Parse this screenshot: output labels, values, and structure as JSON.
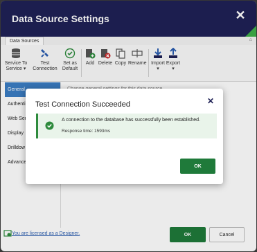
{
  "window": {
    "title": "Data Source Settings"
  },
  "ribbon": {
    "tab": "Data Sources",
    "buttons": {
      "service": "Service To\nService ▾",
      "test": "Test\nConnection",
      "set_default": "Set as\nDefault",
      "add": "Add",
      "delete": "Delete",
      "copy": "Copy",
      "rename": "Rename",
      "import": "Import\n▾",
      "export": "Export\n▾"
    }
  },
  "sidebar": {
    "items": [
      {
        "label": "General",
        "active": true
      },
      {
        "label": "Authenti"
      },
      {
        "label": "Web Serv"
      },
      {
        "label": "Display"
      },
      {
        "label": "Drilldow"
      },
      {
        "label": "Advance"
      }
    ]
  },
  "content": {
    "description": "Change general settings for this data source"
  },
  "footer": {
    "license": "You are licensed as a Designer.",
    "ok_label": "OK",
    "cancel_label": "Cancel"
  },
  "dialog": {
    "title": "Test Connection Succeeded",
    "message": "A connection to the database has successfully been established.",
    "response_time": "Response time: 1593ms",
    "ok_label": "OK"
  },
  "colors": {
    "titlebar": "#1f2156",
    "primary_button": "#1f7a3a",
    "success_bg": "#e9f4ea",
    "active_nav": "#3b7dc4"
  }
}
